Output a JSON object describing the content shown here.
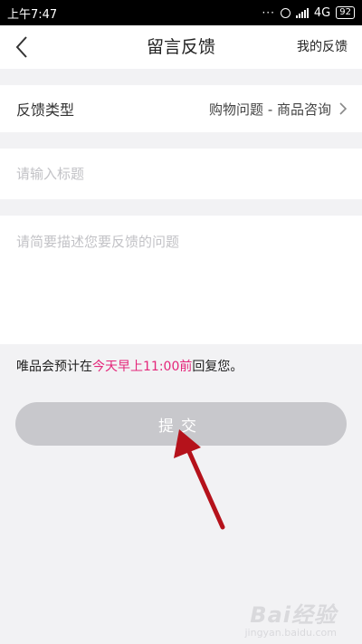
{
  "status": {
    "time": "上午7:47",
    "dots": "···",
    "network": "4G",
    "battery": "92"
  },
  "nav": {
    "title": "留言反馈",
    "my_feedback": "我的反馈"
  },
  "type_row": {
    "label": "反馈类型",
    "value": "购物问题 - 商品咨询"
  },
  "form": {
    "title_placeholder": "请输入标题",
    "title_value": "",
    "desc_placeholder": "请简要描述您要反馈的问题",
    "desc_value": ""
  },
  "eta": {
    "prefix": "唯品会预计在",
    "highlight": "今天早上11:00前",
    "suffix": "回复您。"
  },
  "submit": {
    "label": "提交"
  },
  "watermark": {
    "logo": "Bai经验",
    "site": "jingyan.baidu.com"
  },
  "colors": {
    "accent": "#e4267a",
    "annotation_arrow": "#b5121b",
    "button_disabled": "#c8c8cc"
  },
  "icons": [
    "back-arrow-icon",
    "chevron-right-icon",
    "alarm-icon",
    "signal-icon",
    "battery-icon"
  ]
}
